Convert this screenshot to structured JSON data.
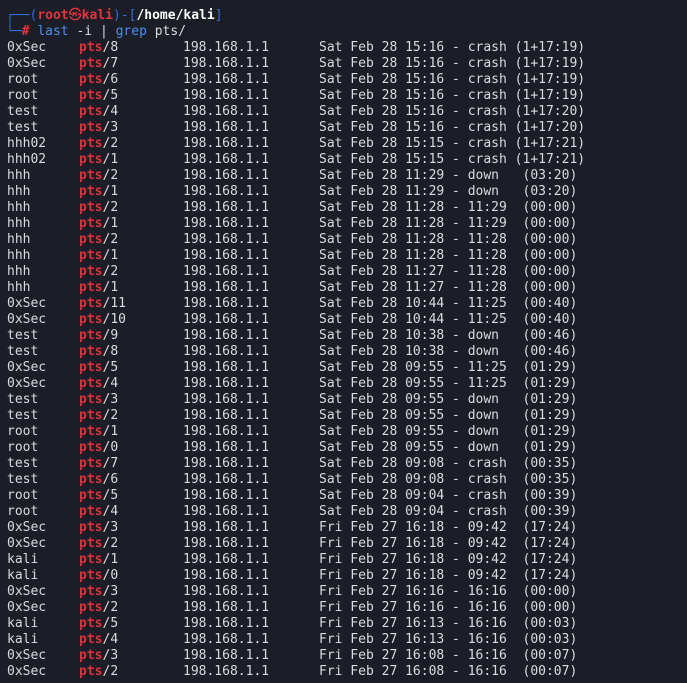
{
  "prompt": {
    "user": "root",
    "skull": "㉿",
    "host": "kali",
    "cwd": "/home/kali",
    "symbol": "#",
    "command": "last",
    "arg1": "-i",
    "pipe": "|",
    "grep": "grep",
    "pattern": "pts/"
  },
  "rows": [
    {
      "user": "0xSec",
      "tty": "pts",
      "num": "8",
      "ip": "198.168.1.1",
      "session": "Sat Feb 28 15:16 - crash (1+17:19)"
    },
    {
      "user": "0xSec",
      "tty": "pts",
      "num": "7",
      "ip": "198.168.1.1",
      "session": "Sat Feb 28 15:16 - crash (1+17:19)"
    },
    {
      "user": "root",
      "tty": "pts",
      "num": "6",
      "ip": "198.168.1.1",
      "session": "Sat Feb 28 15:16 - crash (1+17:19)"
    },
    {
      "user": "root",
      "tty": "pts",
      "num": "5",
      "ip": "198.168.1.1",
      "session": "Sat Feb 28 15:16 - crash (1+17:19)"
    },
    {
      "user": "test",
      "tty": "pts",
      "num": "4",
      "ip": "198.168.1.1",
      "session": "Sat Feb 28 15:16 - crash (1+17:20)"
    },
    {
      "user": "test",
      "tty": "pts",
      "num": "3",
      "ip": "198.168.1.1",
      "session": "Sat Feb 28 15:16 - crash (1+17:20)"
    },
    {
      "user": "hhh02",
      "tty": "pts",
      "num": "2",
      "ip": "198.168.1.1",
      "session": "Sat Feb 28 15:15 - crash (1+17:21)"
    },
    {
      "user": "hhh02",
      "tty": "pts",
      "num": "1",
      "ip": "198.168.1.1",
      "session": "Sat Feb 28 15:15 - crash (1+17:21)"
    },
    {
      "user": "hhh",
      "tty": "pts",
      "num": "2",
      "ip": "198.168.1.1",
      "session": "Sat Feb 28 11:29 - down   (03:20)"
    },
    {
      "user": "hhh",
      "tty": "pts",
      "num": "1",
      "ip": "198.168.1.1",
      "session": "Sat Feb 28 11:29 - down   (03:20)"
    },
    {
      "user": "hhh",
      "tty": "pts",
      "num": "2",
      "ip": "198.168.1.1",
      "session": "Sat Feb 28 11:28 - 11:29  (00:00)"
    },
    {
      "user": "hhh",
      "tty": "pts",
      "num": "1",
      "ip": "198.168.1.1",
      "session": "Sat Feb 28 11:28 - 11:29  (00:00)"
    },
    {
      "user": "hhh",
      "tty": "pts",
      "num": "2",
      "ip": "198.168.1.1",
      "session": "Sat Feb 28 11:28 - 11:28  (00:00)"
    },
    {
      "user": "hhh",
      "tty": "pts",
      "num": "1",
      "ip": "198.168.1.1",
      "session": "Sat Feb 28 11:28 - 11:28  (00:00)"
    },
    {
      "user": "hhh",
      "tty": "pts",
      "num": "2",
      "ip": "198.168.1.1",
      "session": "Sat Feb 28 11:27 - 11:28  (00:00)"
    },
    {
      "user": "hhh",
      "tty": "pts",
      "num": "1",
      "ip": "198.168.1.1",
      "session": "Sat Feb 28 11:27 - 11:28  (00:00)"
    },
    {
      "user": "0xSec",
      "tty": "pts",
      "num": "11",
      "ip": "198.168.1.1",
      "session": "Sat Feb 28 10:44 - 11:25  (00:40)"
    },
    {
      "user": "0xSec",
      "tty": "pts",
      "num": "10",
      "ip": "198.168.1.1",
      "session": "Sat Feb 28 10:44 - 11:25  (00:40)"
    },
    {
      "user": "test",
      "tty": "pts",
      "num": "9",
      "ip": "198.168.1.1",
      "session": "Sat Feb 28 10:38 - down   (00:46)"
    },
    {
      "user": "test",
      "tty": "pts",
      "num": "8",
      "ip": "198.168.1.1",
      "session": "Sat Feb 28 10:38 - down   (00:46)"
    },
    {
      "user": "0xSec",
      "tty": "pts",
      "num": "5",
      "ip": "198.168.1.1",
      "session": "Sat Feb 28 09:55 - 11:25  (01:29)"
    },
    {
      "user": "0xSec",
      "tty": "pts",
      "num": "4",
      "ip": "198.168.1.1",
      "session": "Sat Feb 28 09:55 - 11:25  (01:29)"
    },
    {
      "user": "test",
      "tty": "pts",
      "num": "3",
      "ip": "198.168.1.1",
      "session": "Sat Feb 28 09:55 - down   (01:29)"
    },
    {
      "user": "test",
      "tty": "pts",
      "num": "2",
      "ip": "198.168.1.1",
      "session": "Sat Feb 28 09:55 - down   (01:29)"
    },
    {
      "user": "root",
      "tty": "pts",
      "num": "1",
      "ip": "198.168.1.1",
      "session": "Sat Feb 28 09:55 - down   (01:29)"
    },
    {
      "user": "root",
      "tty": "pts",
      "num": "0",
      "ip": "198.168.1.1",
      "session": "Sat Feb 28 09:55 - down   (01:29)"
    },
    {
      "user": "test",
      "tty": "pts",
      "num": "7",
      "ip": "198.168.1.1",
      "session": "Sat Feb 28 09:08 - crash  (00:35)"
    },
    {
      "user": "test",
      "tty": "pts",
      "num": "6",
      "ip": "198.168.1.1",
      "session": "Sat Feb 28 09:08 - crash  (00:35)"
    },
    {
      "user": "root",
      "tty": "pts",
      "num": "5",
      "ip": "198.168.1.1",
      "session": "Sat Feb 28 09:04 - crash  (00:39)"
    },
    {
      "user": "root",
      "tty": "pts",
      "num": "4",
      "ip": "198.168.1.1",
      "session": "Sat Feb 28 09:04 - crash  (00:39)"
    },
    {
      "user": "0xSec",
      "tty": "pts",
      "num": "3",
      "ip": "198.168.1.1",
      "session": "Fri Feb 27 16:18 - 09:42  (17:24)"
    },
    {
      "user": "0xSec",
      "tty": "pts",
      "num": "2",
      "ip": "198.168.1.1",
      "session": "Fri Feb 27 16:18 - 09:42  (17:24)"
    },
    {
      "user": "kali",
      "tty": "pts",
      "num": "1",
      "ip": "198.168.1.1",
      "session": "Fri Feb 27 16:18 - 09:42  (17:24)"
    },
    {
      "user": "kali",
      "tty": "pts",
      "num": "0",
      "ip": "198.168.1.1",
      "session": "Fri Feb 27 16:18 - 09:42  (17:24)"
    },
    {
      "user": "0xSec",
      "tty": "pts",
      "num": "3",
      "ip": "198.168.1.1",
      "session": "Fri Feb 27 16:16 - 16:16  (00:00)"
    },
    {
      "user": "0xSec",
      "tty": "pts",
      "num": "2",
      "ip": "198.168.1.1",
      "session": "Fri Feb 27 16:16 - 16:16  (00:00)"
    },
    {
      "user": "kali",
      "tty": "pts",
      "num": "5",
      "ip": "198.168.1.1",
      "session": "Fri Feb 27 16:13 - 16:16  (00:03)"
    },
    {
      "user": "kali",
      "tty": "pts",
      "num": "4",
      "ip": "198.168.1.1",
      "session": "Fri Feb 27 16:13 - 16:16  (00:03)"
    },
    {
      "user": "0xSec",
      "tty": "pts",
      "num": "3",
      "ip": "198.168.1.1",
      "session": "Fri Feb 27 16:08 - 16:16  (00:07)"
    },
    {
      "user": "0xSec",
      "tty": "pts",
      "num": "2",
      "ip": "198.168.1.1",
      "session": "Fri Feb 27 16:08 - 16:16  (00:07)"
    }
  ]
}
